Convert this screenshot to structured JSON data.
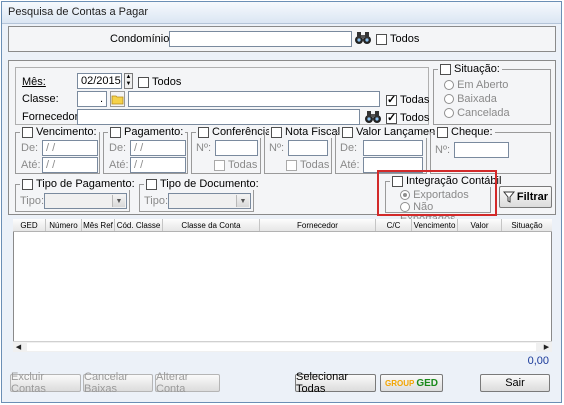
{
  "window": {
    "title": "Pesquisa de Contas a Pagar"
  },
  "condominio": {
    "label": "Condomínio:",
    "value": "",
    "todos_label": "Todos"
  },
  "filters": {
    "mes_label": "Mês:",
    "mes_value": "02/2015",
    "mes_todos": "Todos",
    "classe_label": "Classe:",
    "classe_code": ".",
    "classe_value": "",
    "classe_todos": "Todas",
    "fornecedor_label": "Fornecedor:",
    "fornecedor_value": "",
    "fornecedor_todos": "Todos"
  },
  "situacao": {
    "label": "Situação:",
    "options": [
      "Em Aberto",
      "Baixada",
      "Cancelada"
    ]
  },
  "vencimento": {
    "label": "Vencimento:",
    "de_label": "De:",
    "ate_label": "Até:",
    "de_value": " / /",
    "ate_value": " / /"
  },
  "pagamento": {
    "label": "Pagamento:",
    "de_label": "De:",
    "ate_label": "Até:",
    "de_value": " / /",
    "ate_value": " / /"
  },
  "conferencia": {
    "label": "Conferência:",
    "no_label": "Nº:",
    "todas_label": "Todas"
  },
  "nota_fiscal": {
    "label": "Nota Fiscal:",
    "no_label": "Nº:",
    "todas_label": "Todas"
  },
  "valor_lancamento": {
    "label": "Valor Lançamento:",
    "de_label": "De:",
    "ate_label": "Até:"
  },
  "cheque": {
    "label": "Cheque:",
    "no_label": "Nº:"
  },
  "tipo_pagamento": {
    "label": "Tipo de Pagamento:",
    "tipo_label": "Tipo:"
  },
  "tipo_documento": {
    "label": "Tipo de Documento:",
    "tipo_label": "Tipo:"
  },
  "integracao": {
    "label": "Integração Contábil",
    "options": [
      "Exportados",
      "Não Exportados"
    ]
  },
  "filtrar_label": "Filtrar",
  "table": {
    "columns": [
      "GED",
      "Número",
      "Mês Ref",
      "Cód. Classe",
      "Classe da Conta",
      "Fornecedor",
      "C/C",
      "Vencimento",
      "Valor",
      "Situação"
    ]
  },
  "total": "0,00",
  "buttons": {
    "excluir": "Excluir Contas",
    "cancelar": "Cancelar Baixas",
    "alterar": "Alterar Conta",
    "selecionar": "Selecionar Todas",
    "ged_group": "GROUP",
    "ged_text": "GED",
    "sair": "Sair"
  },
  "colors": {
    "highlight": "#d22a2a",
    "window_border": "#6b8fb5"
  },
  "icons": [
    "binoculars-icon",
    "folder-icon",
    "funnel-icon",
    "spin-arrows-icon",
    "dropdown-arrow-icon"
  ]
}
